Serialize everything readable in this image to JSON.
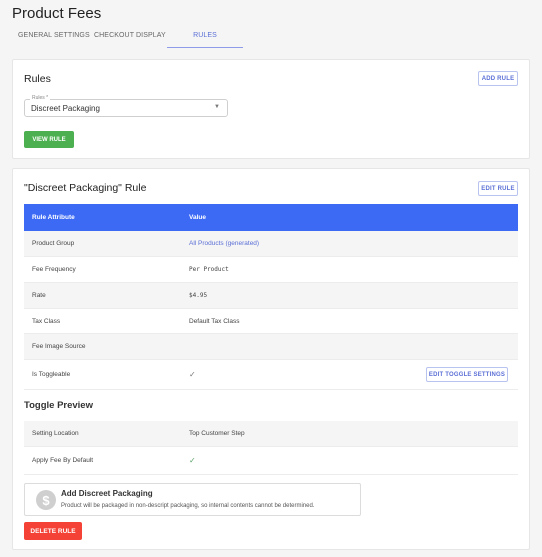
{
  "page": {
    "title": "Product Fees"
  },
  "tabs": [
    {
      "label": "General Settings",
      "active": false
    },
    {
      "label": "Checkout Display",
      "active": false
    },
    {
      "label": "Rules",
      "active": true
    }
  ],
  "rules_card": {
    "title": "Rules",
    "add_button": "Add Rule",
    "select": {
      "label": "Rules *",
      "value": "Discreet Packaging"
    },
    "view_button": "View Rule"
  },
  "rule_card": {
    "title": "\"Discreet Packaging\" Rule",
    "edit_button": "Edit Rule",
    "table": {
      "headers": [
        "Rule Attribute",
        "Value"
      ],
      "rows": [
        {
          "attribute": "Product Group",
          "value": "All Products (generated)"
        },
        {
          "attribute": "Fee Frequency",
          "value": "Per Product"
        },
        {
          "attribute": "Rate",
          "value": "$4.95"
        },
        {
          "attribute": "Tax Class",
          "value": "Default Tax Class"
        },
        {
          "attribute": "Fee Image Source",
          "value": ""
        },
        {
          "attribute": "Is Toggleable",
          "value": "✓"
        }
      ],
      "toggle_button": "Edit Toggle Settings"
    },
    "toggle_preview": {
      "title": "Toggle Preview",
      "rows": [
        {
          "attribute": "Setting Location",
          "value": "Top Customer Step"
        },
        {
          "attribute": "Apply Fee By Default",
          "value": "✓"
        }
      ],
      "preview": {
        "icon": "dollar-coin-icon",
        "title": "Add Discreet Packaging",
        "description": "Product will be packaged in non-descript packaging, so internal contents cannot be determined."
      }
    },
    "delete_button": "Delete Rule"
  },
  "colors": {
    "primary": "#3d6af5",
    "accent_link": "#5b6fd6",
    "success": "#4caf50",
    "danger": "#f44336"
  }
}
